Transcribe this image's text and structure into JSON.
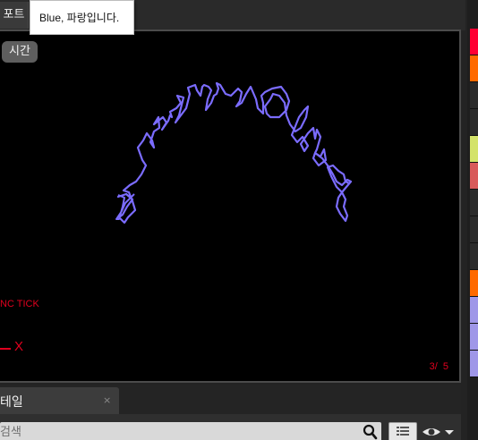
{
  "top": {
    "tab_label": "포트",
    "tooltip": "Blue, 파랑입니다."
  },
  "viewport": {
    "time_button": "시간",
    "sync_tick": "NC TICK",
    "axis_label": "X",
    "page_counter": "3/  5",
    "trace_color": "#7b6cff"
  },
  "swatches": [
    "#ff0033",
    "#ff6a00",
    "#2b2b2b",
    "#2b2b2b",
    "#d4e36a",
    "#d85a5a",
    "#2b2b2b",
    "#2b2b2b",
    "#2b2b2b",
    "#ff6a00",
    "#9f97e8",
    "#9f97e8",
    "#9f97e8"
  ],
  "bottom": {
    "detail_tab": "테일",
    "close_glyph": "×",
    "search_placeholder": "검색"
  },
  "icons": {
    "search": "search-icon",
    "list": "list-icon",
    "eye": "eye-icon"
  }
}
